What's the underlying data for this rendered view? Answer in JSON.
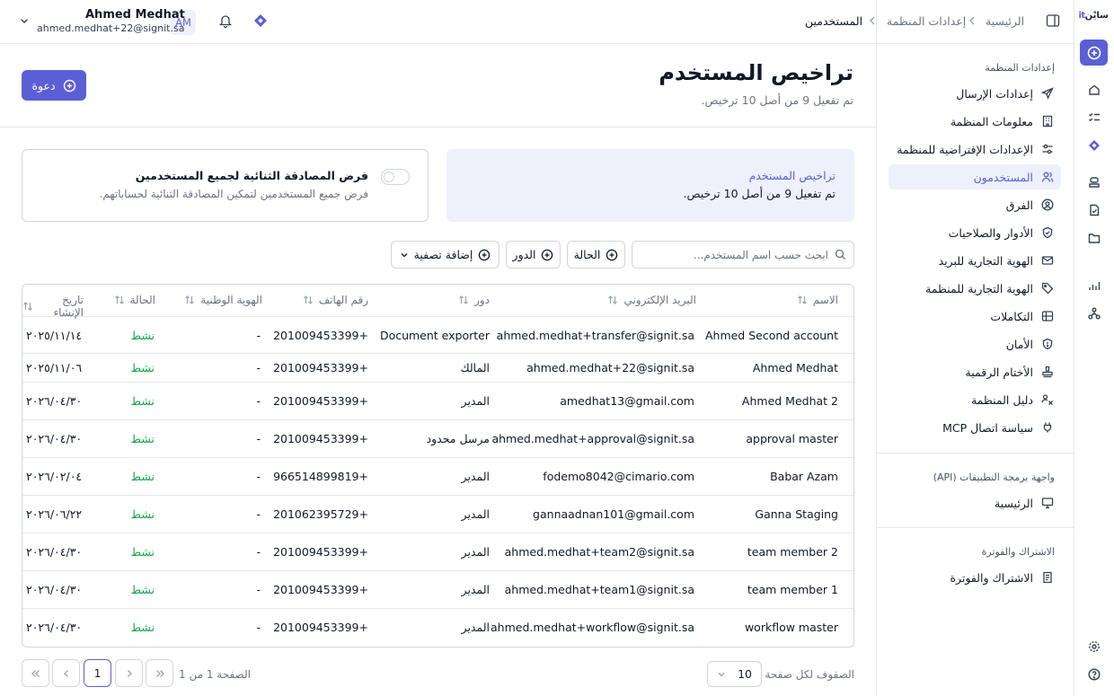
{
  "brand": {
    "name": "سايْن",
    "mark": "it"
  },
  "header": {
    "breadcrumbs": [
      "الرئيسية",
      "إعدادات المنظمة",
      "المستخدمين"
    ],
    "user": {
      "name": "Ahmed Medhat",
      "email": "ahmed.medhat+22@signit.sa",
      "initials": "AM"
    }
  },
  "sidebar": {
    "org_section_title": "إعدادات المنظمة",
    "org_items": [
      {
        "label": "إعدادات الإرسال",
        "icon": "send-icon"
      },
      {
        "label": "معلومات المنظمة",
        "icon": "building-icon"
      },
      {
        "label": "الإعدادات الإفتراضية للمنظمة",
        "icon": "sliders-icon"
      },
      {
        "label": "المستخدمون",
        "icon": "users-icon",
        "active": true
      },
      {
        "label": "الفرق",
        "icon": "team-icon"
      },
      {
        "label": "الأدوار والصلاحيات",
        "icon": "shield-check-icon"
      },
      {
        "label": "الهوية التجارية للبريد",
        "icon": "mail-icon"
      },
      {
        "label": "الهوية التجارية للمنظمة",
        "icon": "tag-icon"
      },
      {
        "label": "التكاملات",
        "icon": "grid-icon"
      },
      {
        "label": "الأمان",
        "icon": "shield-icon"
      },
      {
        "label": "الأختام الرقمية",
        "icon": "stamp-icon"
      },
      {
        "label": "دليل المنظمة",
        "icon": "directory-icon"
      },
      {
        "label": "سياسة اتصال MCP",
        "icon": "plug-icon"
      }
    ],
    "api_section_title": "واجهة برمجة التطبيقات (API)",
    "api_items": [
      {
        "label": "الرئيسية",
        "icon": "monitor-icon"
      }
    ],
    "billing_section_title": "الاشتراك والفوترة",
    "billing_items": [
      {
        "label": "الاشتراك والفوترة",
        "icon": "receipt-icon"
      }
    ]
  },
  "page": {
    "title": "تراخيص المستخدم",
    "subtitle": "تم تفعيل 9 من أصل 10 ترخيص.",
    "invite_label": "دعوة"
  },
  "license_card": {
    "title": "تراخيص المستخدم",
    "text": "تم تفعيل 9 من أصل 10 ترخيص."
  },
  "mfa_card": {
    "title": "فرض المصادقة الثنائية لجميع المستخدمين",
    "description": "فرض جميع المستخدمين لتمكين المصادقة الثنائية لحساباتهم.",
    "enabled": false
  },
  "filters": {
    "search_placeholder": "ابحث حسب اسم المستخدم...",
    "status_label": "الحالة",
    "role_label": "الدور",
    "add_filter_label": "إضافة تصفية"
  },
  "table": {
    "columns": [
      "الاسم",
      "البريد الإلكتروني",
      "دور",
      "رقم الهاتف",
      "الهوية الوطنية",
      "الحالة",
      "تاريخ الإنشاء"
    ],
    "rows": [
      {
        "name": "Ahmed Second account",
        "email": "ahmed.medhat+transfer@signit.sa",
        "role": "Document exporter",
        "phone": "201009453399+",
        "national_id": "-",
        "status": "نشط",
        "created": "٢٠٢٥/١١/١٤"
      },
      {
        "name": "Ahmed Medhat",
        "email": "ahmed.medhat+22@signit.sa",
        "role": "المالك",
        "phone": "201009453399+",
        "national_id": "-",
        "status": "نشط",
        "created": "٢٠٢٥/١١/٠٦"
      },
      {
        "name": "Ahmed Medhat 2",
        "email": "amedhat13@gmail.com",
        "role": "المدير",
        "phone": "201009453399+",
        "national_id": "-",
        "status": "نشط",
        "created": "٢٠٢٦/٠٤/٣٠"
      },
      {
        "name": "approval master",
        "email": "ahmed.medhat+approval@signit.sa",
        "role": "مرسل محدود",
        "phone": "201009453399+",
        "national_id": "-",
        "status": "نشط",
        "created": "٢٠٢٦/٠٤/٣٠"
      },
      {
        "name": "Babar Azam",
        "email": "fodemo8042@cimario.com",
        "role": "المدير",
        "phone": "966514899819+",
        "national_id": "-",
        "status": "نشط",
        "created": "٢٠٢٦/٠٢/٠٤"
      },
      {
        "name": "Ganna Staging",
        "email": "gannaadnan101@gmail.com",
        "role": "المدير",
        "phone": "201062395729+",
        "national_id": "-",
        "status": "نشط",
        "created": "٢٠٢٦/٠٦/٢٢"
      },
      {
        "name": "team member 2",
        "email": "ahmed.medhat+team2@signit.sa",
        "role": "المدير",
        "phone": "201009453399+",
        "national_id": "-",
        "status": "نشط",
        "created": "٢٠٢٦/٠٤/٣٠"
      },
      {
        "name": "team member 1",
        "email": "ahmed.medhat+team1@signit.sa",
        "role": "المدير",
        "phone": "201009453399+",
        "national_id": "-",
        "status": "نشط",
        "created": "٢٠٢٦/٠٤/٣٠"
      },
      {
        "name": "workflow master",
        "email": "ahmed.medhat+workflow@signit.sa",
        "role": "المدير",
        "phone": "201009453399+",
        "national_id": "-",
        "status": "نشط",
        "created": "٢٠٢٦/٠٤/٣٠"
      }
    ]
  },
  "pagination": {
    "rows_per_page_label": "الصفوف لكل صفحة",
    "rows_per_page": "10",
    "page_info": "الصفحة 1 من 1",
    "current_page": "1"
  },
  "colors": {
    "accent": "#5b5fd6",
    "accent_light": "#eef0fb",
    "status_active": "#16a34a",
    "border": "#d1d5db"
  }
}
